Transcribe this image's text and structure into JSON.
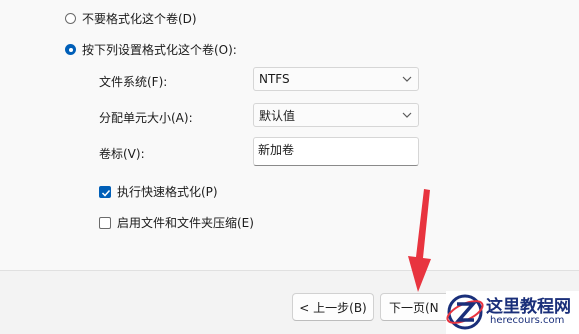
{
  "format_options": {
    "no_format_label": "不要格式化这个卷(D)",
    "format_label": "按下列设置格式化这个卷(O):",
    "selected": "format"
  },
  "fields": {
    "filesystem_label": "文件系统(F):",
    "filesystem_value": "NTFS",
    "allocation_label": "分配单元大小(A):",
    "allocation_value": "默认值",
    "volume_label_label": "卷标(V):",
    "volume_label_value": "新加卷"
  },
  "checkboxes": {
    "quick_format_label": "执行快速格式化(P)",
    "quick_format_checked": true,
    "compression_label": "启用文件和文件夹压缩(E)",
    "compression_checked": false
  },
  "buttons": {
    "back_label": "< 上一步(B)",
    "next_label": "下一页(N"
  },
  "watermark": {
    "title": "这里教程网",
    "subtitle": "herecours.com"
  },
  "colors": {
    "accent": "#005fb8",
    "arrow": "#e8343f",
    "watermark_blue": "#1a2f7a"
  }
}
